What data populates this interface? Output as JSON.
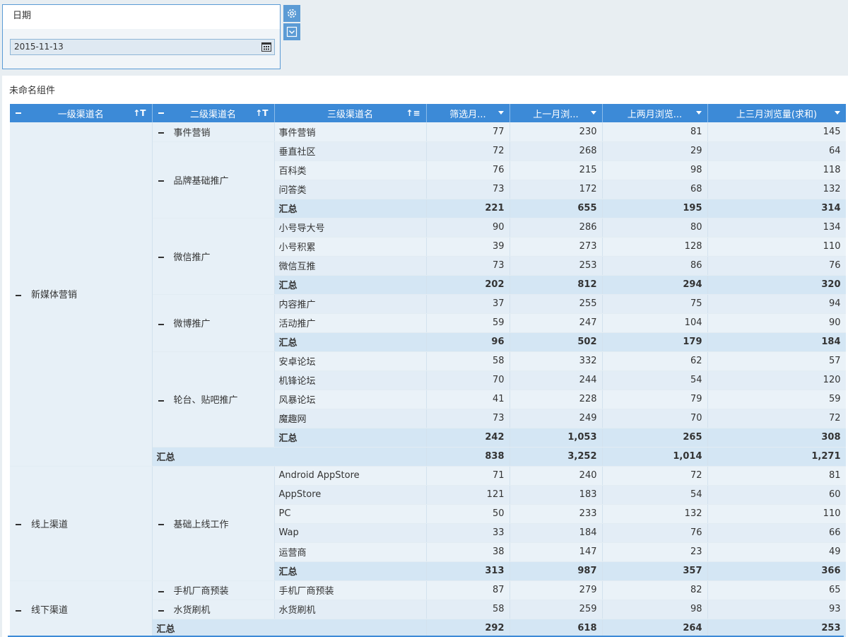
{
  "filter": {
    "title": "日期",
    "date_value": "2015-11-13"
  },
  "widget": {
    "title": "未命名组件"
  },
  "table": {
    "headers": [
      "一级渠道名",
      "二级渠道名",
      "三级渠道名",
      "筛选月...",
      "上一月浏...",
      "上两月浏览...",
      "上三月浏览量(求和)"
    ],
    "rows": [
      {
        "l1": "新媒体营销",
        "l1span": 18,
        "l2": "事件营销",
        "l2span": 1,
        "c3": "事件营销",
        "v": [
          "77",
          "230",
          "81",
          "145"
        ]
      },
      {
        "l2": "品牌基础推广",
        "l2span": 4,
        "c3": "垂直社区",
        "v": [
          "72",
          "268",
          "29",
          "64"
        ]
      },
      {
        "c3": "百科类",
        "v": [
          "76",
          "215",
          "98",
          "118"
        ]
      },
      {
        "c3": "问答类",
        "v": [
          "73",
          "172",
          "68",
          "132"
        ]
      },
      {
        "c3": "汇总",
        "sub": true,
        "v": [
          "221",
          "655",
          "195",
          "314"
        ]
      },
      {
        "l2": "微信推广",
        "l2span": 4,
        "c3": "小号导大号",
        "v": [
          "90",
          "286",
          "80",
          "134"
        ]
      },
      {
        "c3": "小号积累",
        "v": [
          "39",
          "273",
          "128",
          "110"
        ]
      },
      {
        "c3": "微信互推",
        "v": [
          "73",
          "253",
          "86",
          "76"
        ]
      },
      {
        "c3": "汇总",
        "sub": true,
        "v": [
          "202",
          "812",
          "294",
          "320"
        ]
      },
      {
        "l2": "微博推广",
        "l2span": 3,
        "c3": "内容推广",
        "v": [
          "37",
          "255",
          "75",
          "94"
        ]
      },
      {
        "c3": "活动推广",
        "v": [
          "59",
          "247",
          "104",
          "90"
        ]
      },
      {
        "c3": "汇总",
        "sub": true,
        "v": [
          "96",
          "502",
          "179",
          "184"
        ]
      },
      {
        "l2": "轮台、贴吧推广",
        "l2span": 5,
        "c3": "安卓论坛",
        "v": [
          "58",
          "332",
          "62",
          "57"
        ]
      },
      {
        "c3": "机锋论坛",
        "v": [
          "70",
          "244",
          "54",
          "120"
        ]
      },
      {
        "c3": "风暴论坛",
        "v": [
          "41",
          "228",
          "79",
          "59"
        ]
      },
      {
        "c3": "魔趣网",
        "v": [
          "73",
          "249",
          "70",
          "72"
        ]
      },
      {
        "c3": "汇总",
        "sub": true,
        "v": [
          "242",
          "1,053",
          "265",
          "308"
        ]
      },
      {
        "total": "汇总",
        "v": [
          "838",
          "3,252",
          "1,014",
          "1,271"
        ]
      },
      {
        "l1": "线上渠道",
        "l1span": 6,
        "l2": "基础上线工作",
        "l2span": 6,
        "c3": "Android AppStore",
        "v": [
          "71",
          "240",
          "72",
          "81"
        ]
      },
      {
        "c3": "AppStore",
        "v": [
          "121",
          "183",
          "54",
          "60"
        ]
      },
      {
        "c3": "PC",
        "v": [
          "50",
          "233",
          "132",
          "110"
        ]
      },
      {
        "c3": "Wap",
        "v": [
          "33",
          "184",
          "76",
          "66"
        ]
      },
      {
        "c3": "运营商",
        "v": [
          "38",
          "147",
          "23",
          "49"
        ]
      },
      {
        "c3": "汇总",
        "sub": true,
        "v": [
          "313",
          "987",
          "357",
          "366"
        ]
      },
      {
        "l1": "线下渠道",
        "l1span": 3,
        "l2": "手机厂商预装",
        "l2span": 1,
        "c3": "手机厂商预装",
        "v": [
          "87",
          "279",
          "82",
          "65"
        ]
      },
      {
        "l2": "水货刷机",
        "l2span": 1,
        "c3": "水货刷机",
        "v": [
          "58",
          "259",
          "98",
          "93"
        ]
      },
      {
        "total": "汇总",
        "v": [
          "292",
          "618",
          "264",
          "253"
        ]
      }
    ]
  },
  "colors": {
    "accent": "#3c8ad7",
    "header_bg": "#3c8ad7",
    "subtotal_bg": "#d4e6f4"
  }
}
